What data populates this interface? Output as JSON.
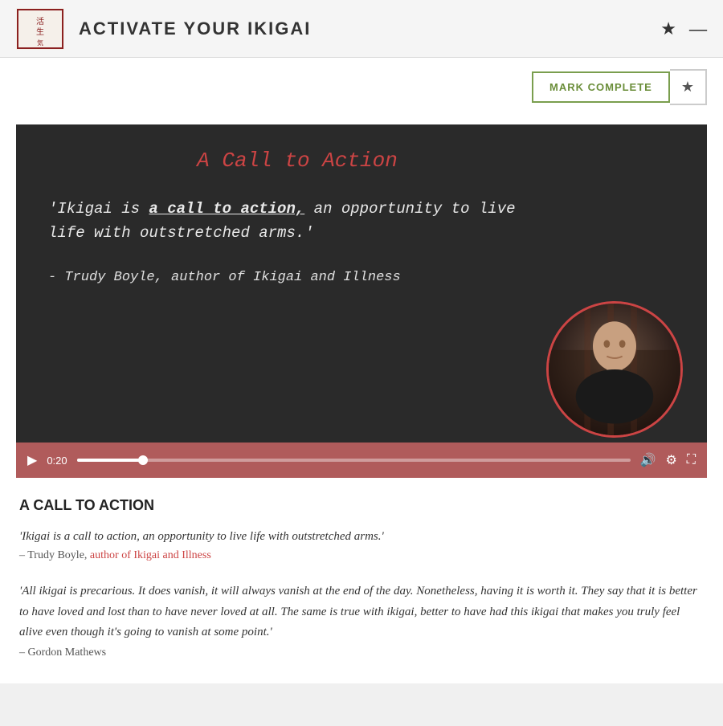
{
  "header": {
    "title": "ACTIVATE YOUR IKIGAI",
    "star_icon": "★",
    "minus_icon": "—"
  },
  "toolbar": {
    "mark_complete_label": "MARK COMPLETE",
    "star_label": "★"
  },
  "video": {
    "title": "A Call to Action",
    "quote_prefix": "'Ikigai is ",
    "quote_bold": "a call to action,",
    "quote_suffix": " an opportunity to live life with outstretched arms.'",
    "attribution": "- Trudy Boyle, author of Ikigai and Illness",
    "time": "0:20",
    "progress_percent": 12
  },
  "content": {
    "section_title": "A CALL TO ACTION",
    "quote1": "'Ikigai is a call to action, an opportunity to live life with outstretched arms.'",
    "attribution1_prefix": "– Trudy Boyle, ",
    "attribution1_link": "author of Ikigai and Illness",
    "quote2": "'All ikigai is precarious. It does vanish, it will always vanish at the end of the day. Nonetheless, having it is worth it. They say that it is better to have loved and lost than to have never loved at all. The same is true with ikigai, better to have had this ikigai that makes you truly feel alive even though it's going to vanish at some point.'",
    "attribution2": "– Gordon Mathews"
  }
}
